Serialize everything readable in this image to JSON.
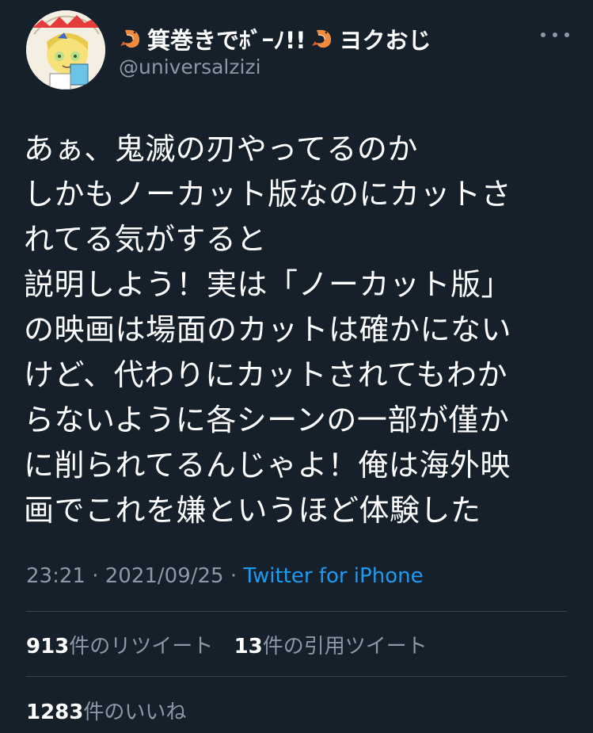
{
  "author": {
    "display_name": "箕巻きでﾎﾞｰﾉ!!",
    "display_name_suffix": "ヨクおじ",
    "handle": "@universalzizi",
    "name_emoji": "shrimp-icon"
  },
  "tweet": {
    "lines": [
      "あぁ、鬼滅の刃やってるのか",
      "しかもノーカット版なのにカットさ",
      "れてる気がすると",
      "説明しよう！実は「ノーカット版」",
      "の映画は場面のカットは確かにない",
      "けど、代わりにカットされてもわか",
      "らないように各シーンの一部が僅か",
      "に削られてるんじゃよ！俺は海外映",
      "画でこれを嫌というほど体験した"
    ]
  },
  "meta": {
    "time": "23:21",
    "separator1": " · ",
    "date": "2021/09/25",
    "separator2": " · ",
    "source": "Twitter for iPhone"
  },
  "stats": {
    "retweets_count": "913",
    "retweets_label": "件のリツイート",
    "quotes_count": "13",
    "quotes_label": "件の引用ツイート",
    "likes_count": "1283",
    "likes_label": "件のいいね"
  },
  "colors": {
    "background": "#15202b",
    "secondary_text": "#8b98a5",
    "link": "#1d9bf0",
    "divider": "#38444d"
  }
}
